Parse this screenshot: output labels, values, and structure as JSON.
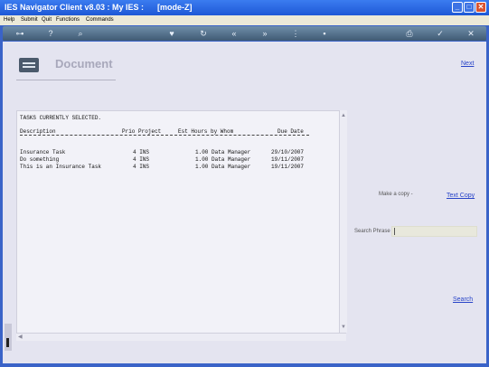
{
  "window": {
    "title": "IES Navigator Client v8.03 : My IES :      [mode-Z]"
  },
  "menu": [
    "Help",
    "Submit",
    "Quit",
    "Functions",
    "Commands"
  ],
  "toolbar_icons": [
    "key-icon",
    "help-icon",
    "search-icon",
    "heart-icon",
    "refresh-icon",
    "back-icon",
    "forward-icon",
    "filter-icon",
    "save-icon",
    "print-icon",
    "ok-icon",
    "close-icon"
  ],
  "page": {
    "title": "Document",
    "next_link": "Next"
  },
  "report": {
    "heading": "TASKS CURRENTLY SELECTED.",
    "columns": [
      "Description",
      "Prio Project",
      "Est Hours by Whom",
      "Due Date"
    ],
    "rows": [
      {
        "description": "Insurance Task",
        "prio_project": "4 INS",
        "hours_whom": "1.00 Data Manager",
        "due_date": "29/10/2007"
      },
      {
        "description": "Do something",
        "prio_project": "4 INS",
        "hours_whom": "1.00 Data Manager",
        "due_date": "19/11/2007"
      },
      {
        "description": "This is an Insurance Task",
        "prio_project": "4 INS",
        "hours_whom": "1.00 Data Manager",
        "due_date": "19/11/2007"
      }
    ]
  },
  "side": {
    "copy_label": "Make a copy -",
    "copy_link": "Text Copy",
    "search_label": "Search Phrase",
    "search_value": "",
    "hint": "",
    "search_link": "Search"
  },
  "colors": {
    "accent": "#2844c8",
    "hint": "#e8a04c",
    "titlebar": "#2a64e0"
  }
}
